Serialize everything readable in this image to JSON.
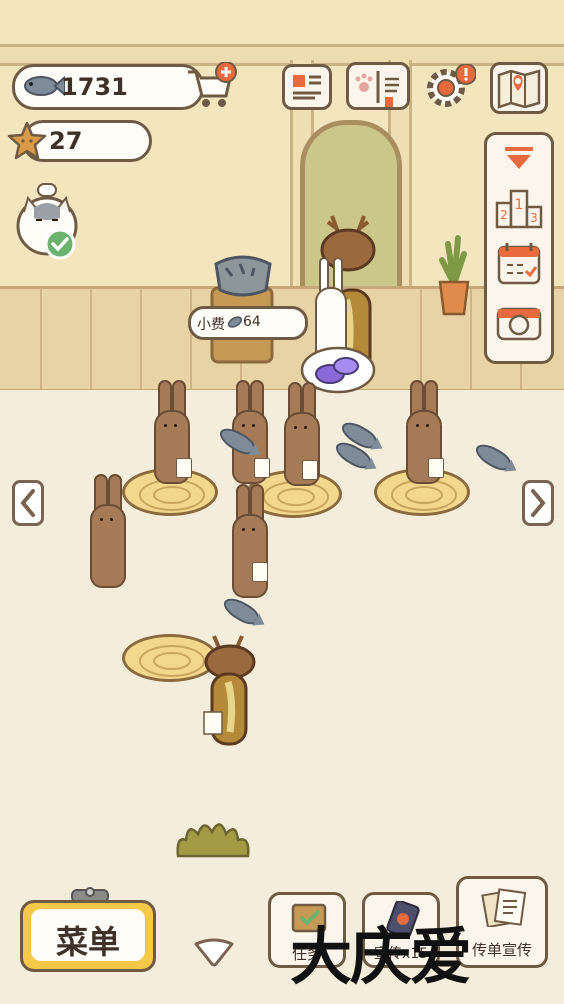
{
  "resources": {
    "fish_count": "1731",
    "star_count": "27"
  },
  "tip_bubble": {
    "label": "小费",
    "amount": "64"
  },
  "bottom_bar": {
    "menu_label": "菜单",
    "tasks_label": "任务",
    "promo_label": "宣传x15",
    "flyer_label": "传单宣传"
  },
  "watermark": "大庆爱",
  "icons": {
    "fish": "fish-icon",
    "cart": "shop-cart-plus-icon",
    "news": "newspaper-icon",
    "recipe_book": "paw-book-icon",
    "settings": "gear-alert-icon",
    "map": "map-icon",
    "collapse": "collapse-arrow-icon",
    "ranking": "podium-icon",
    "calendar": "calendar-icon",
    "camera": "camera-icon"
  },
  "colors": {
    "outline": "#6f5a44",
    "menu_button": "#f7c94a",
    "alert": "#e86a3e",
    "check": "#6db36f"
  }
}
